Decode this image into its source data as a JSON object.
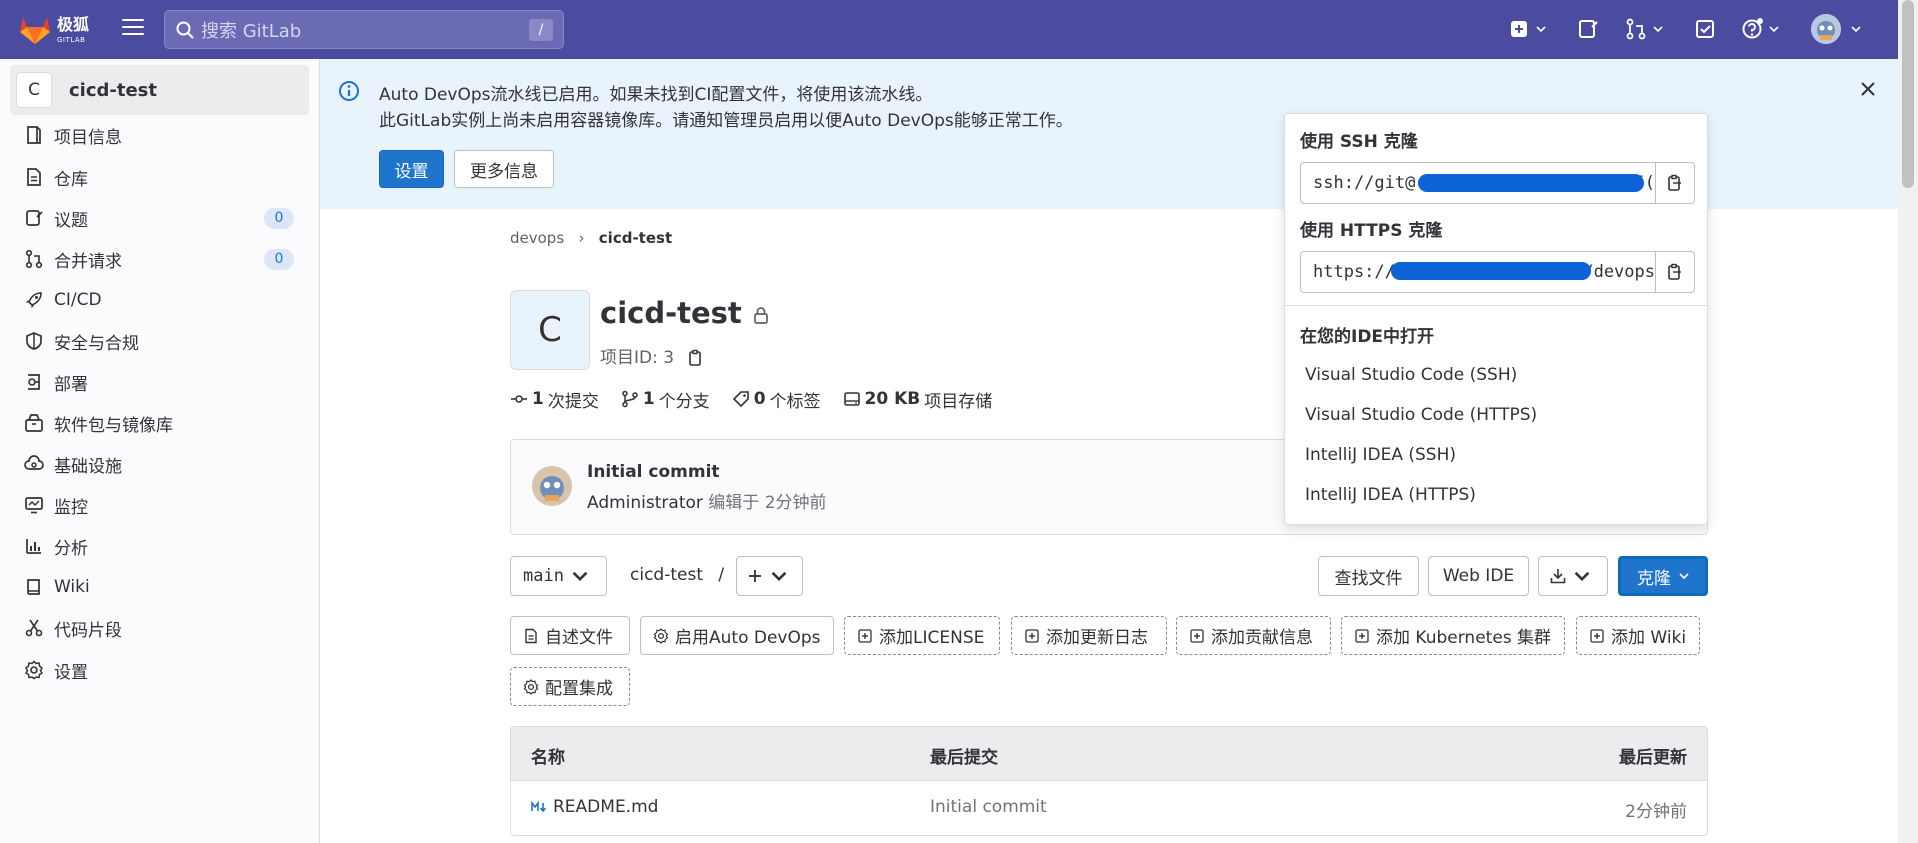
{
  "topbar": {
    "logo_text": "极狐",
    "logo_sub": "GITLAB",
    "search_placeholder": "搜索 GitLab",
    "search_shortcut": "/"
  },
  "sidebar": {
    "project_initial": "C",
    "project_name": "cicd-test",
    "items": [
      {
        "label": "项目信息",
        "icon": "info-icon"
      },
      {
        "label": "仓库",
        "icon": "document-icon"
      },
      {
        "label": "议题",
        "icon": "issues-icon",
        "badge": "0"
      },
      {
        "label": "合并请求",
        "icon": "merge-request-icon",
        "badge": "0"
      },
      {
        "label": "CI/CD",
        "icon": "rocket-icon"
      },
      {
        "label": "安全与合规",
        "icon": "shield-icon"
      },
      {
        "label": "部署",
        "icon": "deploy-icon"
      },
      {
        "label": "软件包与镜像库",
        "icon": "package-icon"
      },
      {
        "label": "基础设施",
        "icon": "cloud-icon"
      },
      {
        "label": "监控",
        "icon": "monitor-icon"
      },
      {
        "label": "分析",
        "icon": "chart-icon"
      },
      {
        "label": "Wiki",
        "icon": "book-icon"
      },
      {
        "label": "代码片段",
        "icon": "snippet-icon"
      },
      {
        "label": "设置",
        "icon": "gear-icon"
      }
    ]
  },
  "alert": {
    "line1": "Auto DevOps流水线已启用。如果未找到CI配置文件，将使用该流水线。",
    "line2": "此GitLab实例上尚未启用容器镜像库。请通知管理员启用以便Auto DevOps能够正常工作。",
    "primary_button": "设置",
    "secondary_button": "更多信息"
  },
  "breadcrumb": {
    "parent": "devops",
    "current": "cicd-test"
  },
  "project": {
    "initial": "C",
    "title": "cicd-test",
    "id_label": "项目ID: 3"
  },
  "stats": [
    {
      "value": "1",
      "label": "次提交"
    },
    {
      "value": "1",
      "label": "个分支"
    },
    {
      "value": "0",
      "label": "个标签"
    },
    {
      "value": "20 KB",
      "label": "项目存储"
    }
  ],
  "commit": {
    "title": "Initial commit",
    "author": "Administrator",
    "meta": "编辑于 2分钟前"
  },
  "repo_bar": {
    "branch": "main",
    "path": "cicd-test",
    "path_sep": "/",
    "find_file": "查找文件",
    "web_ide": "Web IDE",
    "clone": "克隆"
  },
  "actions": [
    {
      "label": "自述文件",
      "style": "solid",
      "icon": "document-icon"
    },
    {
      "label": "启用Auto DevOps",
      "style": "solid",
      "icon": "gear-icon"
    },
    {
      "label": "添加LICENSE",
      "style": "dashed",
      "icon": "plus-square-icon"
    },
    {
      "label": "添加更新日志",
      "style": "dashed",
      "icon": "plus-square-icon"
    },
    {
      "label": "添加贡献信息",
      "style": "dashed",
      "icon": "plus-square-icon"
    },
    {
      "label": "添加 Kubernetes 集群",
      "style": "dashed",
      "icon": "plus-square-icon"
    },
    {
      "label": "添加 Wiki",
      "style": "dashed",
      "icon": "plus-square-icon"
    },
    {
      "label": "配置集成",
      "style": "dashed",
      "icon": "gear-icon"
    }
  ],
  "table": {
    "headers": [
      "名称",
      "最后提交",
      "最后更新"
    ],
    "rows": [
      {
        "name": "README.md",
        "commit": "Initial commit",
        "updated": "2分钟前"
      }
    ]
  },
  "clone_dropdown": {
    "ssh_heading": "使用 SSH 克隆",
    "ssh_url_start": "ssh://git@",
    "ssh_url_end": ":555(",
    "https_heading": "使用 HTTPS 克隆",
    "https_url_start": "https://",
    "https_url_end": "d/devops",
    "ide_heading": "在您的IDE中打开",
    "ide_items": [
      "Visual Studio Code (SSH)",
      "Visual Studio Code (HTTPS)",
      "IntelliJ IDEA (SSH)",
      "IntelliJ IDEA (HTTPS)"
    ]
  },
  "colors": {
    "topbar": "#4b4ba0",
    "primary": "#1f75cb",
    "alert_bg": "#e9f3fc"
  }
}
